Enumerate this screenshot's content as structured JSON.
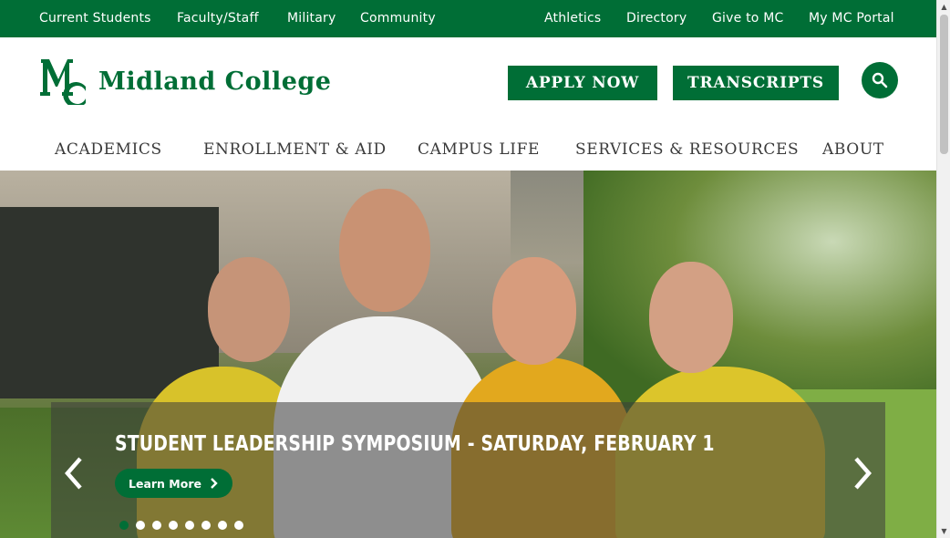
{
  "utility_nav": {
    "left": [
      "Current Students",
      "Faculty/Staff",
      "Military",
      "Community"
    ],
    "right": [
      "Athletics",
      "Directory",
      "Give to MC",
      "My MC Portal"
    ]
  },
  "header": {
    "logo_text": "Midland College",
    "apply_label": "APPLY NOW",
    "transcripts_label": "TRANSCRIPTS"
  },
  "main_nav": [
    "ACADEMICS",
    "ENROLLMENT & AID",
    "CAMPUS LIFE",
    "SERVICES & RESOURCES",
    "ABOUT"
  ],
  "hero": {
    "slide_title": "STUDENT LEADERSHIP SYMPOSIUM - SATURDAY, FEBRUARY 1",
    "button_label": "Learn More",
    "dot_count": 8,
    "active_dot": 0
  },
  "colors": {
    "brand_green": "#006e36",
    "nav_text": "#3a3a3a"
  },
  "icons": [
    "search-icon",
    "chevron-right-icon",
    "arrow-left-icon",
    "arrow-right-icon"
  ]
}
